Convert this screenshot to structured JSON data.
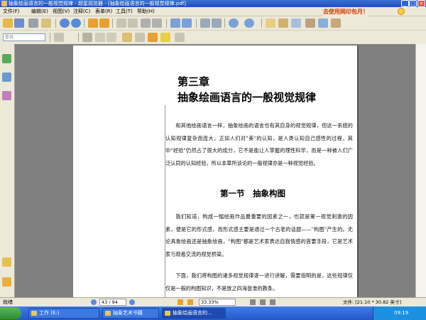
{
  "window": {
    "title": "抽象绘画语言的一般视觉规律 - 超星阅览器 - [抽象绘画语言的一般视觉规律.pdf]",
    "promo_text": "去使用网印包月！",
    "colors": {
      "title_bar": "#1c4fc0",
      "chrome": "#ece9d8",
      "promo": "#d63a00"
    }
  },
  "menu": {
    "items": [
      "文件(F)",
      "编辑(E)",
      "视图(V)",
      "注释(C)",
      "表单(R)",
      "工具(T)",
      "帮助(H)"
    ]
  },
  "toolbar": {
    "find_placeholder": "查找",
    "icons": [
      "open-icon",
      "save-icon",
      "print-icon",
      "email-icon",
      "up-icon",
      "down-icon",
      "back-icon",
      "forward-icon",
      "hand-icon",
      "select-icon",
      "undo-icon",
      "redo-icon",
      "zoom-in-icon",
      "zoom-out-icon",
      "rotate-icon",
      "snapshot-icon",
      "comment-icon",
      "highlight-icon",
      "note-icon",
      "text-icon"
    ]
  },
  "document": {
    "chapter_number": "第三章",
    "chapter_title": "抽象绘画语言的一般视觉规律",
    "paragraphs": [
      "和其他绘画语言一样，抽象绘画的语言也有其自身的视觉规律，但这一系统的认知规律复杂而庞大，正如人们对\"美\"的认知，是人类认知自己感性的过程，其中\"经验\"仍然占了很大的成分，它不是能让人掌握的理性科学，而是一种被人们广泛认同的认知经验，所以本章所谈论的一般视律亦是一种视觉经验。",
      "我们知道，构成一幅绘画作品最重要的因素之一，也就是第一视觉刺激的因素，便是它的形式感，而形式感主要是通过一个古老的话题——\"构图\"产生的。无论具象绘画还是抽象绘画，\"构图\"都是艺术家表达自我情感的首要手段，它是艺术家与观者交流的视觉桥梁。",
      "下面，我们将构图的诸多视觉规律逐一进行讲解，需要指明的是，这些规律仅仅是一般的构图知识，不是放之四海皆准的教条。"
    ],
    "section_title": "第一节　抽象构图"
  },
  "statusbar": {
    "ready": "就绪",
    "page_indicator": "43 / 94",
    "zoom": "33.33%",
    "page_size": "文件: [21.10 * 30.82 英寸]"
  },
  "taskbar": {
    "start_icon": "windows-logo-icon",
    "tasks": [
      {
        "label": "工作 (E:)"
      },
      {
        "label": "抽象艺术书籍"
      },
      {
        "label": "抽象绘画语言的..."
      }
    ],
    "clock": "09:19"
  }
}
